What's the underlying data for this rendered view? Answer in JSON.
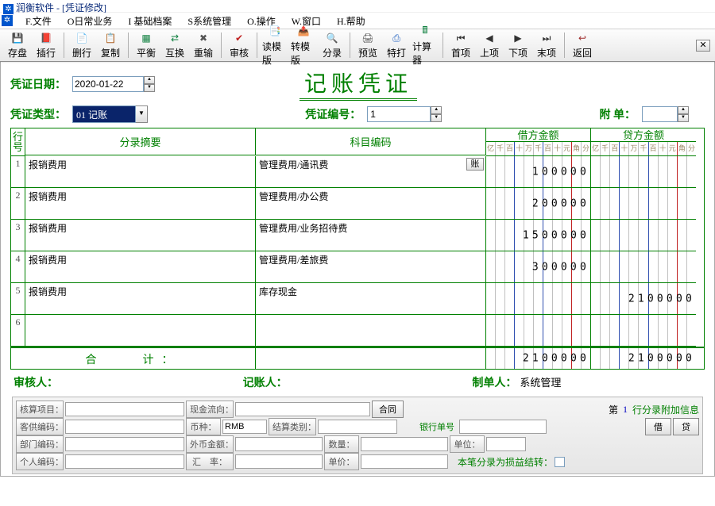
{
  "window": {
    "title": "润衡软件 - [凭证修改]"
  },
  "menu": [
    "F.文件",
    "O日常业务",
    "I 基础档案",
    "S系统管理",
    "O.操作",
    "W.窗口",
    "H.帮助"
  ],
  "toolbar": [
    {
      "label": "存盘",
      "icon": "💾",
      "color": "#2040a0"
    },
    {
      "label": "插行",
      "icon": "📕",
      "color": "#b04000"
    },
    {
      "sep": true
    },
    {
      "label": "删行",
      "icon": "📄",
      "color": "#2060c0"
    },
    {
      "label": "复制",
      "icon": "📋",
      "color": "#2060c0"
    },
    {
      "sep": true
    },
    {
      "label": "平衡",
      "icon": "▦",
      "color": "#108040"
    },
    {
      "label": "互换",
      "icon": "⇄",
      "color": "#108040"
    },
    {
      "label": "重输",
      "icon": "✖",
      "color": "#555"
    },
    {
      "sep": true
    },
    {
      "label": "审核",
      "icon": "✔",
      "color": "#c02020"
    },
    {
      "sep": true
    },
    {
      "label": "读模版",
      "icon": "📑",
      "color": "#a03030"
    },
    {
      "label": "转模版",
      "icon": "📤",
      "color": "#2060c0"
    },
    {
      "label": "分录",
      "icon": "🔍",
      "color": "#555"
    },
    {
      "sep": true
    },
    {
      "label": "预览",
      "icon": "🖨",
      "color": "#555"
    },
    {
      "label": "特打",
      "icon": "⎙",
      "color": "#2060c0"
    },
    {
      "label": "计算器",
      "icon": "🖩",
      "color": "#108040"
    },
    {
      "sep": true
    },
    {
      "label": "首项",
      "icon": "⏮",
      "color": "#333"
    },
    {
      "label": "上项",
      "icon": "◀",
      "color": "#333"
    },
    {
      "label": "下项",
      "icon": "▶",
      "color": "#333"
    },
    {
      "label": "末项",
      "icon": "⏭",
      "color": "#333"
    },
    {
      "sep": true
    },
    {
      "label": "返回",
      "icon": "↩",
      "color": "#a03030"
    }
  ],
  "header": {
    "date_label": "凭证日期：",
    "date": "2020-01-22",
    "title": "记账凭证",
    "type_label": "凭证类型：",
    "type": "01 记账",
    "seq_label": "凭证编号：",
    "seq": "1",
    "att_label": "附 单：",
    "att": ""
  },
  "grid": {
    "cols": {
      "rownum": "行号",
      "abs": "分录摘要",
      "subj": "科目编码",
      "debit": "借方金额",
      "credit": "贷方金额"
    },
    "unit_labels": [
      "亿",
      "千",
      "百",
      "十",
      "万",
      "千",
      "百",
      "十",
      "元",
      "角",
      "分"
    ],
    "subj_btn": "账",
    "rows": [
      {
        "n": "1",
        "abs": "报销费用",
        "subj": "管理费用/通讯费",
        "debit": "100000",
        "credit": ""
      },
      {
        "n": "2",
        "abs": "报销费用",
        "subj": "管理费用/办公费",
        "debit": "200000",
        "credit": ""
      },
      {
        "n": "3",
        "abs": "报销费用",
        "subj": "管理费用/业务招待费",
        "debit": "1500000",
        "credit": ""
      },
      {
        "n": "4",
        "abs": "报销费用",
        "subj": "管理费用/差旅费",
        "debit": "300000",
        "credit": ""
      },
      {
        "n": "5",
        "abs": "报销费用",
        "subj": "库存现金",
        "debit": "",
        "credit": "2100000"
      },
      {
        "n": "6",
        "abs": "",
        "subj": "",
        "debit": "",
        "credit": ""
      }
    ],
    "total_label": "合　　计：",
    "total_debit": "2100000",
    "total_credit": "2100000"
  },
  "signers": {
    "audit": "审核人：",
    "book": "记账人：",
    "maker": "制单人：",
    "maker_val": "系统管理"
  },
  "footer": {
    "row1": {
      "a": "核算项目：",
      "b": "现金流向：",
      "c": "合同",
      "d_pre": "第",
      "d_num": "1",
      "d_post": "行分录附加信息"
    },
    "row2": {
      "a": "客供编码：",
      "b": "币种：",
      "b_val": "RMB",
      "c": "结算类别：",
      "d": "银行单号",
      "e": "借",
      "f": "贷"
    },
    "row3": {
      "a": "部门编码：",
      "b": "外币金额：",
      "c": "数量：",
      "d": "单位："
    },
    "row4": {
      "a": "个人编码：",
      "b": "汇　率：",
      "c": "单价：",
      "d": "本笔分录为损益结转："
    }
  }
}
